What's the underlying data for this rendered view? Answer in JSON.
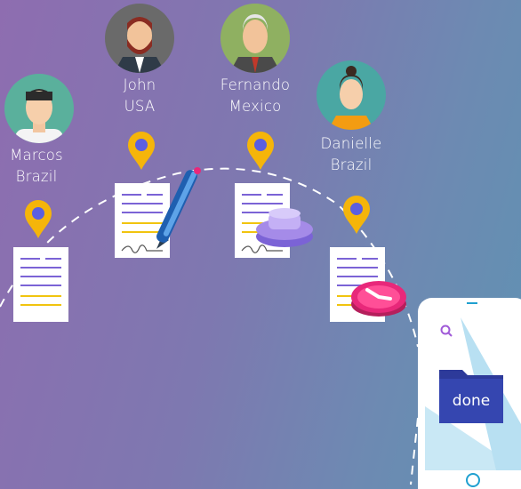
{
  "people": [
    {
      "name": "Marcos",
      "country": "Brazil"
    },
    {
      "name": "John",
      "country": "USA"
    },
    {
      "name": "Fernando",
      "country": "Mexico"
    },
    {
      "name": "Danielle",
      "country": "Brazil"
    }
  ],
  "phone": {
    "folder_label": "done"
  },
  "colors": {
    "pin": "#f5b50a",
    "pin_dot": "#5b5fe0",
    "doc_line_purple": "#7b63d6",
    "doc_line_yellow": "#f1c40f",
    "clock": "#e8287a"
  }
}
